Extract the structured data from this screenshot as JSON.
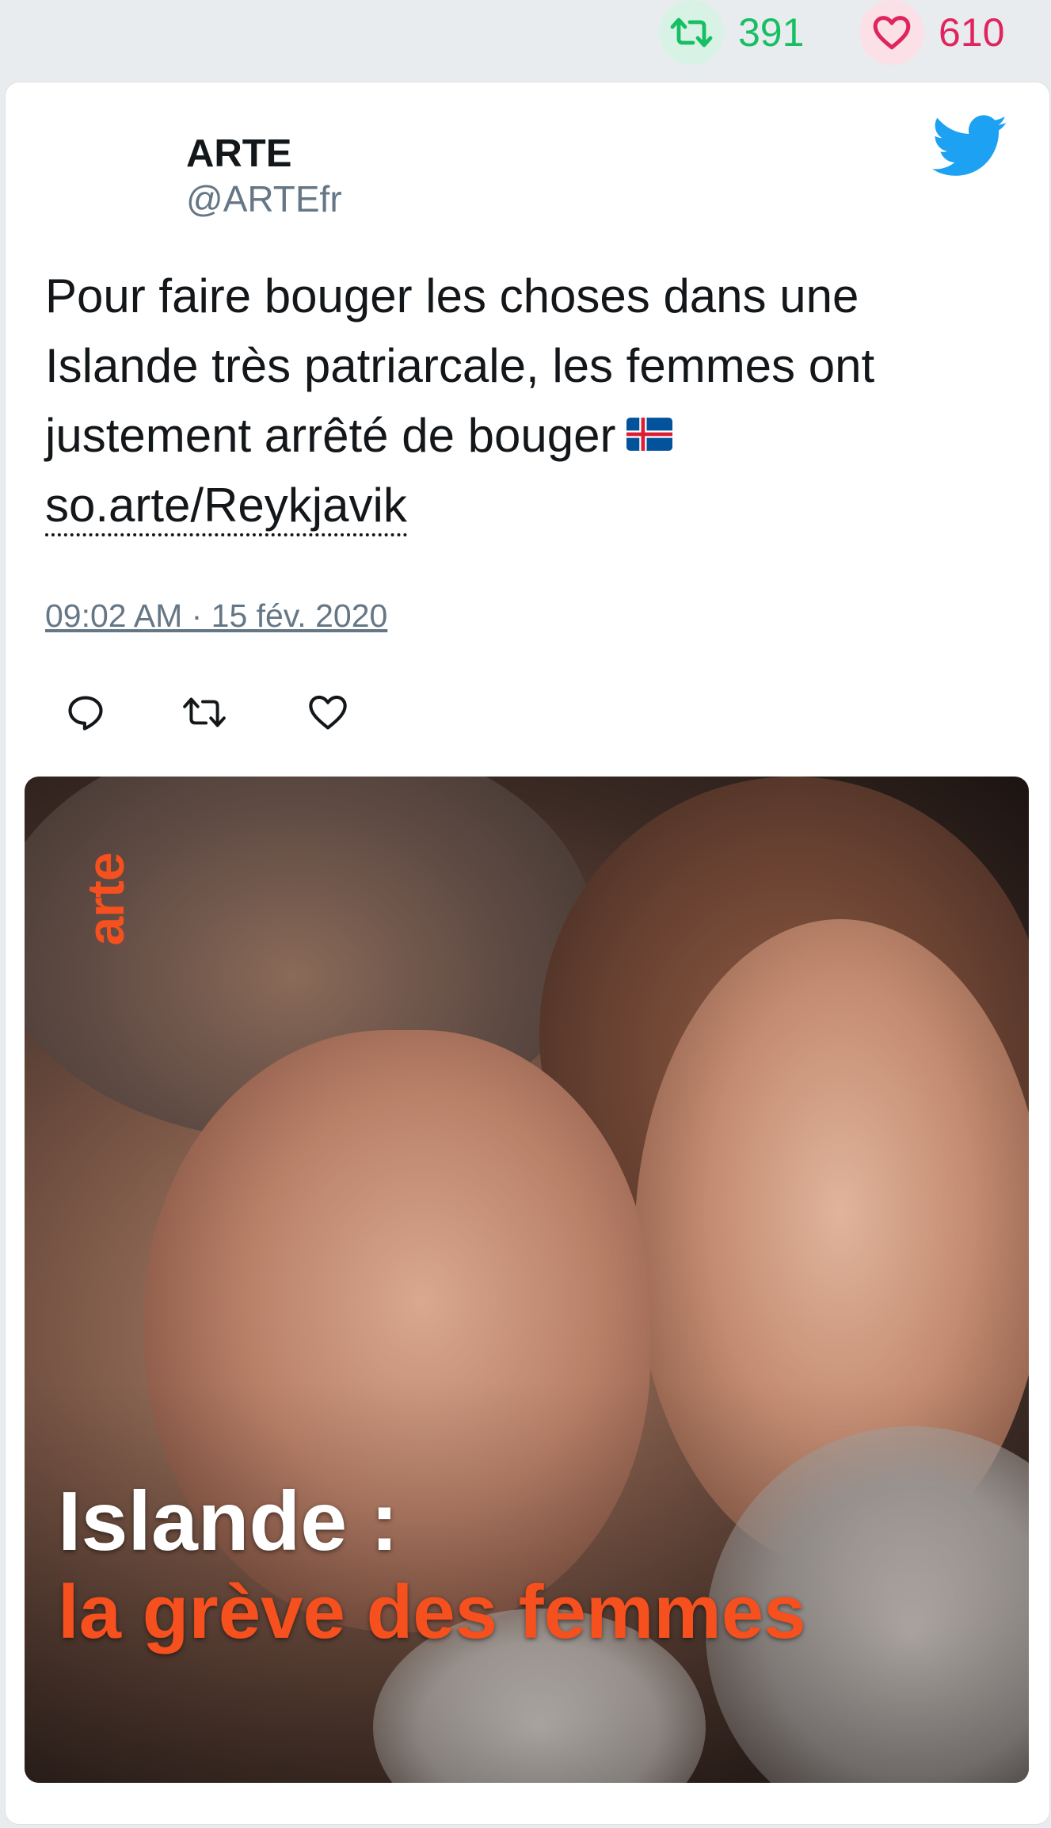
{
  "stats": {
    "retweets": "391",
    "likes": "610",
    "retweet_icon": "retweet-icon",
    "like_icon": "heart-icon",
    "retweet_color": "#17bf63",
    "like_color": "#e0245e"
  },
  "tweet": {
    "author_name": "ARTE",
    "author_handle": "@ARTEfr",
    "text": "Pour faire bouger les choses dans une Islande très patriarcale, les femmes ont justement arrêté de bouger",
    "flag_icon": "iceland-flag-icon",
    "link_text": "so.arte/Reykjavik",
    "timestamp": "09:02 AM · 15 fév. 2020",
    "brand_icon": "twitter-bird-icon",
    "brand_color": "#1da1f2"
  },
  "actions": {
    "reply_icon": "reply-icon",
    "retweet_icon": "retweet-icon",
    "like_icon": "heart-icon"
  },
  "media": {
    "logo_text": "arte",
    "title": "Islande :",
    "subtitle": "la grève des femmes",
    "accent_color": "#f5501e"
  }
}
